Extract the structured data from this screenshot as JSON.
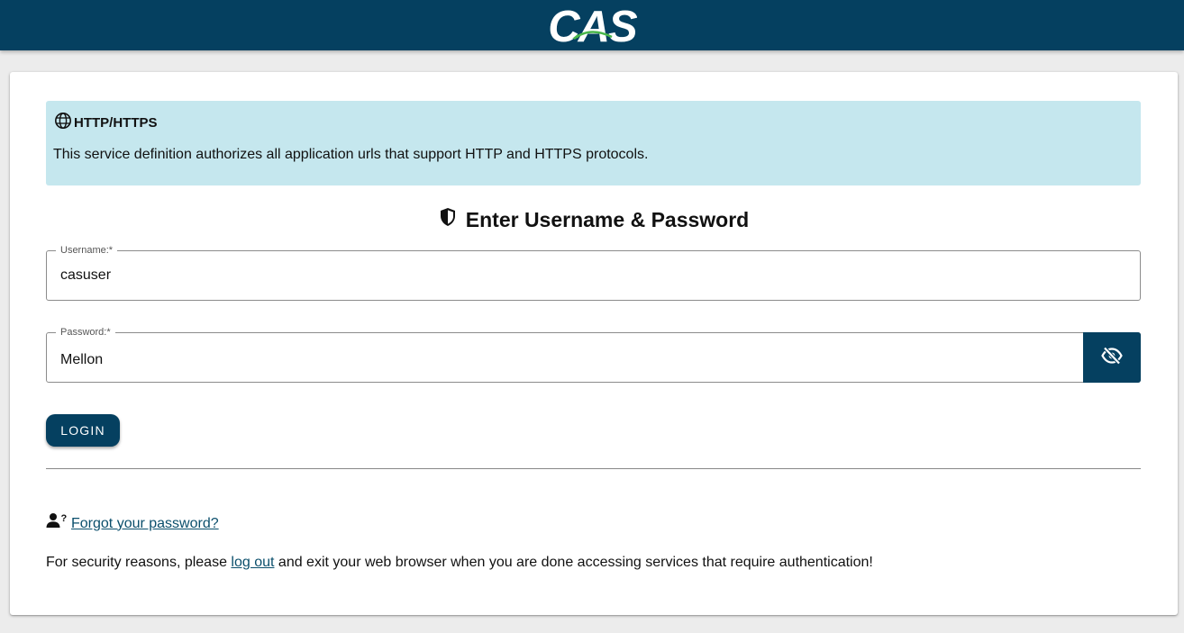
{
  "header": {
    "logo_text": "CAS"
  },
  "service": {
    "icon": "globe-icon",
    "title": "HTTP/HTTPS",
    "description": "This service definition authorizes all application urls that support HTTP and HTTPS protocols."
  },
  "form": {
    "heading": "Enter Username & Password",
    "heading_icon": "shield-icon",
    "username_label": "Username:*",
    "username_value": "casuser",
    "password_label": "Password:*",
    "password_value": "Mellon",
    "toggle_icon": "eye-off-icon",
    "login_label": "LOGIN"
  },
  "footer": {
    "forgot_icon": "user-question-icon",
    "forgot_text": "Forgot your password?",
    "security_prefix": "For security reasons, please ",
    "logout_text": "log out",
    "security_suffix": " and exit your web browser when you are done accessing services that require authentication!"
  },
  "colors": {
    "brand": "#054060",
    "info_bg": "#c5e7ee",
    "link": "#0b4f6c"
  }
}
